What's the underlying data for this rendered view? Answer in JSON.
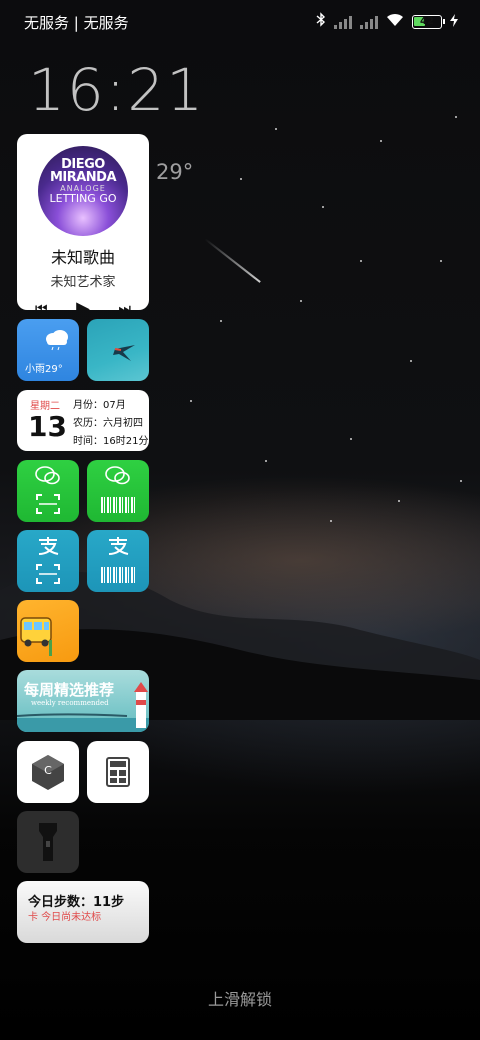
{
  "status_bar": {
    "carrier": "无服务 | 无服务",
    "battery_level": "42",
    "battery_fraction": 0.42
  },
  "lockscreen": {
    "time": "16:21",
    "date_temp": "29°",
    "unlock_hint": "上滑解锁"
  },
  "music_widget": {
    "album_line1": "DIEGO",
    "album_line2": "MIRANDA",
    "album_line3": "ANALOGE",
    "album_line4": "LETTING GO",
    "song": "未知歌曲",
    "artist": "未知艺术家",
    "prev_icon": "⏮",
    "play_icon": "▶",
    "next_icon": "⏭"
  },
  "weather_widget": {
    "label": "小雨29°",
    "icon": "cloud-rain-icon"
  },
  "calendar_widget": {
    "weekday": "星期二",
    "day": "13",
    "month": "月份：07月",
    "lunar": "农历：六月初四",
    "time": "时间：16时21分"
  },
  "weekly_widget": {
    "title": "每周精选推荐",
    "subtitle": "weekly recommended"
  },
  "steps_widget": {
    "title": "今日步数：11步",
    "note": "卡  今日尚未达标"
  },
  "colors": {
    "wechat_green": "#2fd042",
    "alipay_teal": "#28a8c8",
    "weather_blue": "#3b92ea",
    "bus_orange": "#f9a31a"
  }
}
